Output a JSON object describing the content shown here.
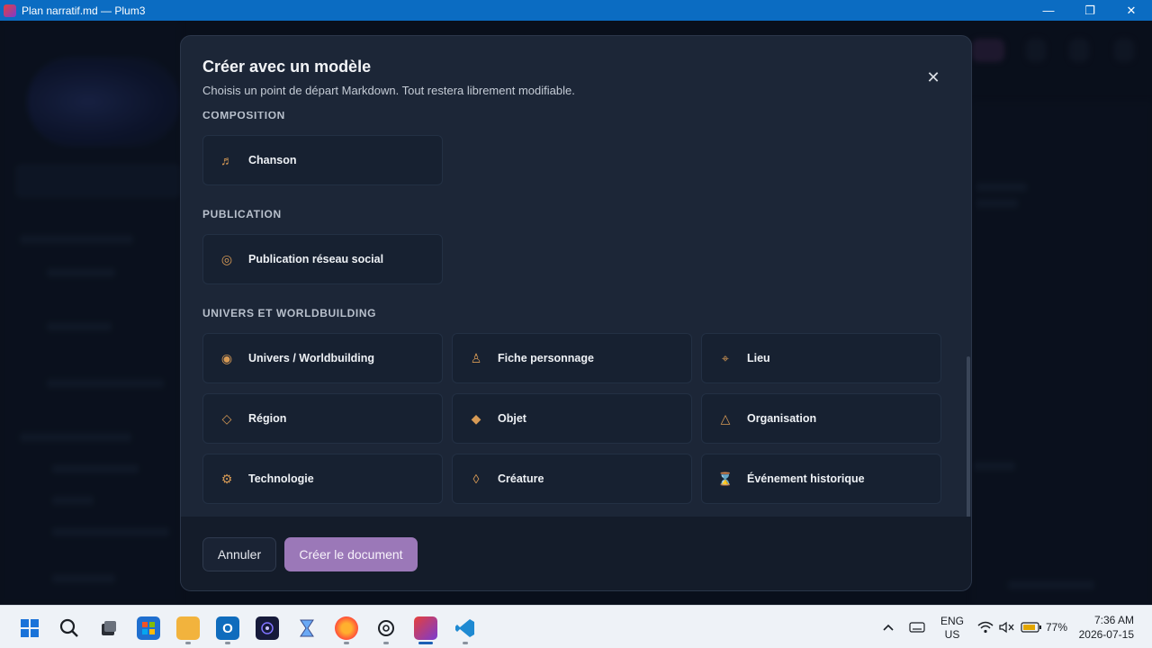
{
  "window": {
    "title": "Plan narratif.md — Plum3",
    "minimize": "—",
    "maximize": "❐",
    "close": "✕"
  },
  "modal": {
    "title": "Créer avec un modèle",
    "subtitle": "Choisis un point de départ Markdown. Tout restera librement modifiable.",
    "close_glyph": "✕",
    "sections": [
      {
        "label": "COMPOSITION",
        "items": [
          {
            "label": "Chanson",
            "icon": "music-note-icon",
            "glyph": "♬"
          }
        ]
      },
      {
        "label": "PUBLICATION",
        "items": [
          {
            "label": "Publication réseau social",
            "icon": "target-circle-icon",
            "glyph": "◎"
          }
        ]
      },
      {
        "label": "UNIVERS ET WORLDBUILDING",
        "items": [
          {
            "label": "Univers / Worldbuilding",
            "icon": "filled-circle-icon",
            "glyph": "◉"
          },
          {
            "label": "Fiche personnage",
            "icon": "person-icon",
            "glyph": "♙"
          },
          {
            "label": "Lieu",
            "icon": "location-pin-icon",
            "glyph": "⌖"
          },
          {
            "label": "Région",
            "icon": "diamond-outline-icon",
            "glyph": "◇"
          },
          {
            "label": "Objet",
            "icon": "diamond-filled-icon",
            "glyph": "◆"
          },
          {
            "label": "Organisation",
            "icon": "triangle-icon",
            "glyph": "△"
          },
          {
            "label": "Technologie",
            "icon": "gear-icon",
            "glyph": "⚙"
          },
          {
            "label": "Créature",
            "icon": "small-diamond-icon",
            "glyph": "◊"
          },
          {
            "label": "Événement historique",
            "icon": "hourglass-icon",
            "glyph": "⌛"
          }
        ]
      }
    ],
    "cancel_label": "Annuler",
    "create_label": "Créer le document"
  },
  "colors": {
    "accent": "#9b78b8",
    "icon": "#d79a55",
    "modal_bg": "#1c2637",
    "titlebar": "#0b6cc2"
  },
  "taskbar": {
    "lang_line1": "ENG",
    "lang_line2": "US",
    "battery": "77%",
    "time": "7:36 AM",
    "date": "2026-07-15"
  }
}
